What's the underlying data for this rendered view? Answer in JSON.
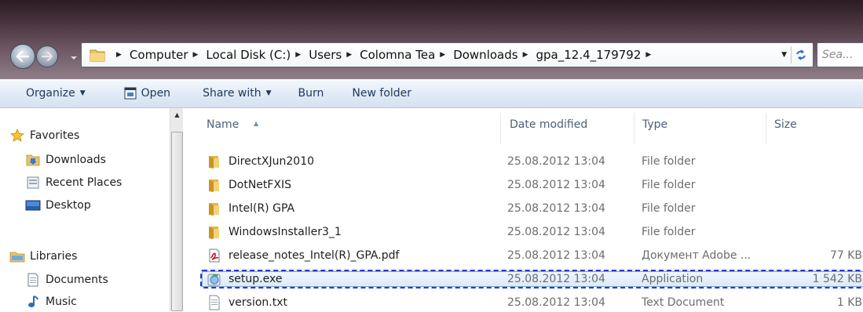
{
  "address": {
    "crumbs": [
      "Computer",
      "Local Disk (C:)",
      "Users",
      "Colomna Tea",
      "Downloads",
      "gpa_12.4_179792"
    ],
    "search_placeholder": "Sea..."
  },
  "toolbar": {
    "organize": "Organize",
    "open": "Open",
    "share_with": "Share with",
    "burn": "Burn",
    "new_folder": "New folder"
  },
  "nav": {
    "favorites": "Favorites",
    "downloads": "Downloads",
    "recent_places": "Recent Places",
    "desktop": "Desktop",
    "libraries": "Libraries",
    "documents": "Documents",
    "music": "Music"
  },
  "columns": {
    "name": "Name",
    "date": "Date modified",
    "type": "Type",
    "size": "Size"
  },
  "files": [
    {
      "name": "DirectXJun2010",
      "date": "25.08.2012 13:04",
      "type": "File folder",
      "size": "",
      "icon": "folder-icon"
    },
    {
      "name": "DotNetFXIS",
      "date": "25.08.2012 13:04",
      "type": "File folder",
      "size": "",
      "icon": "folder-icon"
    },
    {
      "name": "Intel(R) GPA",
      "date": "25.08.2012 13:04",
      "type": "File folder",
      "size": "",
      "icon": "folder-icon"
    },
    {
      "name": "WindowsInstaller3_1",
      "date": "25.08.2012 13:04",
      "type": "File folder",
      "size": "",
      "icon": "folder-icon"
    },
    {
      "name": "release_notes_Intel(R)_GPA.pdf",
      "date": "25.08.2012 13:04",
      "type": "Документ Adobe ...",
      "size": "77 KB",
      "icon": "pdf-icon"
    },
    {
      "name": "setup.exe",
      "date": "25.08.2012 13:04",
      "type": "Application",
      "size": "1 542 KB",
      "icon": "setup-exe-icon"
    },
    {
      "name": "version.txt",
      "date": "25.08.2012 13:04",
      "type": "Text Document",
      "size": "1 KB",
      "icon": "text-file-icon"
    }
  ],
  "selected_file": "setup.exe"
}
